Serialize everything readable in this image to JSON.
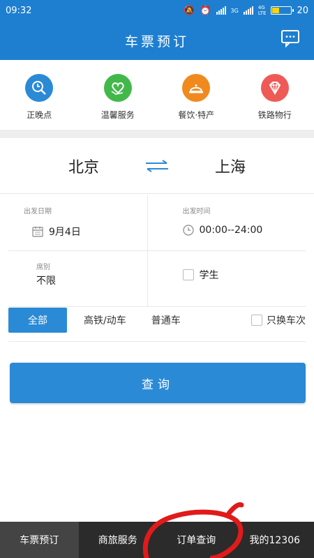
{
  "status": {
    "time": "09:32",
    "network1": "3G",
    "network2": "4G",
    "network2_sub": "LTE",
    "battery": "20"
  },
  "header": {
    "title": "车票预订",
    "message_icon": "chat-bubble-icon"
  },
  "services": [
    {
      "label": "正晚点",
      "icon": "clock-search-icon",
      "color": "#2a8ad6"
    },
    {
      "label": "温馨服务",
      "icon": "heart-hand-icon",
      "color": "#43b84a"
    },
    {
      "label": "餐饮·特产",
      "icon": "cloche-icon",
      "color": "#f08a1e"
    },
    {
      "label": "铁路物行",
      "icon": "diamond-icon",
      "color": "#ef5a57"
    }
  ],
  "route": {
    "from": "北京",
    "to": "上海"
  },
  "date": {
    "label": "出发日期",
    "value": "9月4日"
  },
  "time_range": {
    "label": "出发时间",
    "value": "00:00--24:00"
  },
  "seat": {
    "label": "席别",
    "value": "不限"
  },
  "student": {
    "label": "学生"
  },
  "filters": {
    "all": "全部",
    "gaotie": "高铁/动车",
    "putong": "普通车",
    "transfer": "只换车次"
  },
  "query_label": "查询",
  "tabs": [
    "车票预订",
    "商旅服务",
    "订单查询",
    "我的12306"
  ]
}
